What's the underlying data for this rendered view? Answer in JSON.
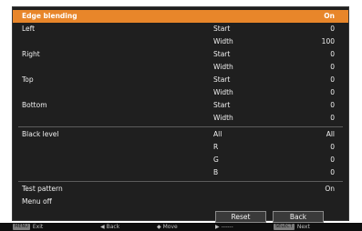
{
  "menu": {
    "rows": [
      {
        "label": "Edge blending",
        "sub": "",
        "value": "On",
        "selected": true
      },
      {
        "label": "Left",
        "sub": "Start",
        "value": "0"
      },
      {
        "label": "",
        "sub": "Width",
        "value": "100"
      },
      {
        "label": "Right",
        "sub": "Start",
        "value": "0"
      },
      {
        "label": "",
        "sub": "Width",
        "value": "0"
      },
      {
        "label": "Top",
        "sub": "Start",
        "value": "0"
      },
      {
        "label": "",
        "sub": "Width",
        "value": "0"
      },
      {
        "label": "Bottom",
        "sub": "Start",
        "value": "0"
      },
      {
        "label": "",
        "sub": "Width",
        "value": "0"
      },
      {
        "label": "Black level",
        "sub": "All",
        "value": "All"
      },
      {
        "label": "",
        "sub": "R",
        "value": "0"
      },
      {
        "label": "",
        "sub": "G",
        "value": "0"
      },
      {
        "label": "",
        "sub": "B",
        "value": "0"
      },
      {
        "label": "Test pattern",
        "sub": "",
        "value": "On"
      },
      {
        "label": "Menu off",
        "sub": "",
        "value": ""
      }
    ],
    "buttons": {
      "reset": "Reset",
      "back": "Back"
    }
  },
  "statusbar": {
    "exit_key": "MENU",
    "exit": "Exit",
    "back_glyph": "◀",
    "back": "Back",
    "move_glyph": "◆",
    "move": "Move",
    "dash_glyph": "▶",
    "dash": "------",
    "next_key": "SELECT",
    "next": "Next"
  },
  "colors": {
    "highlight": "#e8862a",
    "panel": "#1f1f1f",
    "text": "#f0f0f0"
  }
}
